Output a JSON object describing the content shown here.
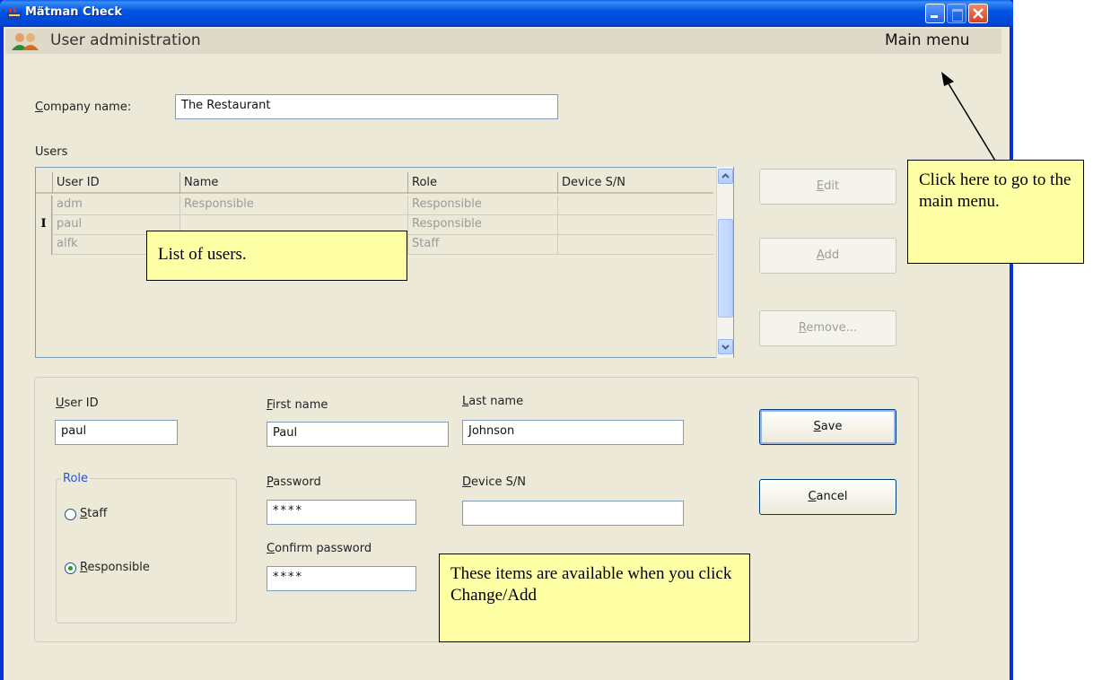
{
  "window": {
    "title": "Mätman Check"
  },
  "header": {
    "title": "User administration",
    "main_menu": "Main menu"
  },
  "company": {
    "label": "Company name:",
    "value": "The Restaurant"
  },
  "users": {
    "label": "Users",
    "columns": [
      "User ID",
      "Name",
      "Role",
      "Device S/N"
    ],
    "rows": [
      {
        "user_id": "adm",
        "name": "Responsible",
        "role": "Responsible",
        "device": ""
      },
      {
        "user_id": "paul",
        "name": "",
        "role": "Responsible",
        "device": "",
        "indicator": "I"
      },
      {
        "user_id": "alfk",
        "name": "",
        "role": "Staff",
        "device": ""
      }
    ]
  },
  "buttons": {
    "edit": "Edit",
    "add": "Add",
    "remove": "Remove...",
    "save": "Save",
    "cancel": "Cancel"
  },
  "detail": {
    "user_id_label": "User ID",
    "user_id": "paul",
    "first_name_label": "First name",
    "first_name": "Paul",
    "last_name_label": "Last name",
    "last_name": "Johnson",
    "password_label": "Password",
    "password": "****",
    "confirm_label": "Confirm password",
    "confirm": "****",
    "device_label": "Device S/N",
    "device": "",
    "role_label": "Role",
    "role_staff": "Staff",
    "role_responsible": "Responsible",
    "role_selected": "Responsible"
  },
  "callouts": {
    "main_menu": "Click here to go to the main menu.",
    "list": "List of users.",
    "items": "These items are available when you click Change/Add"
  }
}
